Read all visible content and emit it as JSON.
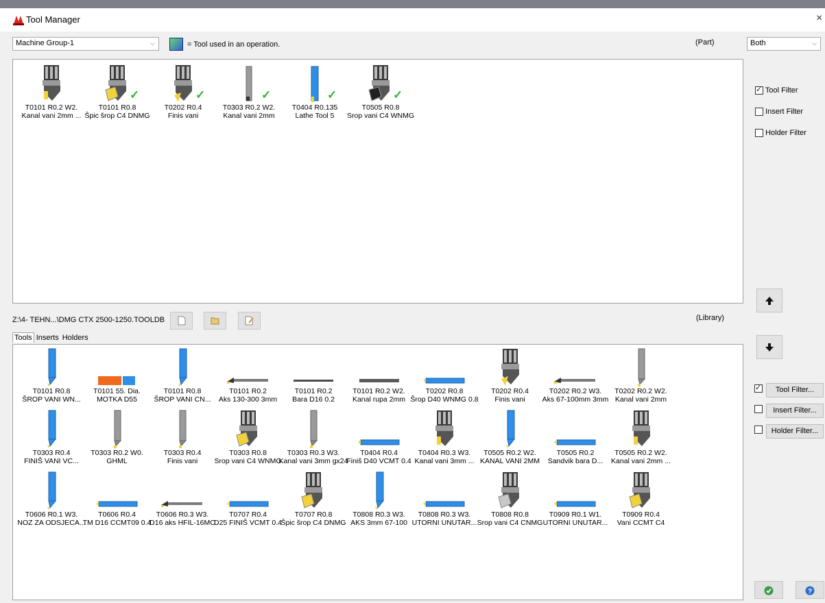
{
  "window": {
    "title": "Tool Manager",
    "close": "×"
  },
  "header": {
    "group_select": "Machine Group-1",
    "legend_text": "= Tool used in an operation.",
    "part_label": "(Part)",
    "both_select": "Both"
  },
  "part_tools": [
    {
      "l1": "T0101 R0.2 W2.",
      "l2": "Kanal vani 2mm ...",
      "used": false,
      "icon": "holder-grooving"
    },
    {
      "l1": "T0101 R0.8",
      "l2": "Špic šrop C4 DNMG",
      "used": true,
      "icon": "holder-insert-yellow"
    },
    {
      "l1": "T0202 R0.4",
      "l2": "Finis vani",
      "used": true,
      "icon": "holder-finish"
    },
    {
      "l1": "T0303 R0.2 W2.",
      "l2": "Kanal vani 2mm",
      "used": true,
      "icon": "grooving-bar"
    },
    {
      "l1": "T0404 R0.135",
      "l2": "Lathe Tool 5",
      "used": true,
      "icon": "blue-bar-tool"
    },
    {
      "l1": "T0505 R0.8",
      "l2": "Srop vani C4 WNMG",
      "used": true,
      "icon": "holder-insert-black"
    }
  ],
  "part_filters": [
    {
      "label": "Tool Filter",
      "checked": true
    },
    {
      "label": "Insert Filter",
      "checked": false
    },
    {
      "label": "Holder Filter",
      "checked": false
    }
  ],
  "library": {
    "path": "Z:\\4- TEHN...\\DMG CTX 2500-1250.TOOLDB",
    "label": "(Library)",
    "tabs": [
      "Tools",
      "Inserts",
      "Holders"
    ],
    "tools": [
      {
        "l1": "T0101 R0.8",
        "l2": "ŠROP VANI WN...",
        "icon": "blue-vertical-tool"
      },
      {
        "l1": "T0101 55. Dia.",
        "l2": "MOTKA D55",
        "icon": "orange-blue-bar"
      },
      {
        "l1": "T0101 R0.8",
        "l2": "ŠROP VANI CN...",
        "icon": "blue-vertical-tool"
      },
      {
        "l1": "T0101 R0.2",
        "l2": "Aks 130-300 3mm",
        "icon": "boring-bar-gray"
      },
      {
        "l1": "T0101 R0.2",
        "l2": "Bara D16 0.2",
        "icon": "thin-bar-gray"
      },
      {
        "l1": "T0101 R0.2 W2.",
        "l2": "Kanal rupa 2mm",
        "icon": "thick-bar-gray"
      },
      {
        "l1": "T0202 R0.8",
        "l2": "Šrop D40 WNMG 0.8",
        "icon": "blue-bar-horizontal"
      },
      {
        "l1": "T0202 R0.4",
        "l2": "Finis vani",
        "icon": "holder-finish"
      },
      {
        "l1": "T0202 R0.2 W3.",
        "l2": "Aks 67-100mm 3mm",
        "icon": "boring-bar-gray"
      },
      {
        "l1": "T0202 R0.2 W2.",
        "l2": "Kanal vani 2mm",
        "icon": "gray-vertical-tool"
      },
      {
        "l1": "T0303 R0.4",
        "l2": "FINIŠ VANI VC...",
        "icon": "blue-vertical-tool"
      },
      {
        "l1": "T0303 R0.2 W0.",
        "l2": "GHML",
        "icon": "gray-vertical-tool"
      },
      {
        "l1": "T0303 R0.4",
        "l2": "Finis vani",
        "icon": "gray-vertical-tool"
      },
      {
        "l1": "T0303 R0.8",
        "l2": "Srop vani C4 WNMG",
        "icon": "holder-insert-yellow"
      },
      {
        "l1": "T0303 R0.3 W3.",
        "l2": "Kanal vani 3mm gx24",
        "icon": "gray-vertical-tool"
      },
      {
        "l1": "T0404 R0.4",
        "l2": "Finiš D40 VCMT 0.4",
        "icon": "blue-bar-horizontal"
      },
      {
        "l1": "T0404 R0.3 W3.",
        "l2": "Kanal vani 3mm ...",
        "icon": "holder-grooving"
      },
      {
        "l1": "T0505 R0.2 W2.",
        "l2": "KANAL VANI 2MM",
        "icon": "blue-vertical-tool"
      },
      {
        "l1": "T0505 R0.2",
        "l2": "Sandvik bara D...",
        "icon": "blue-bar-horizontal"
      },
      {
        "l1": "T0505 R0.2 W2.",
        "l2": "Kanal vani 2mm ...",
        "icon": "holder-grooving"
      },
      {
        "l1": "T0606 R0.1 W3.",
        "l2": "NOZ ZA ODSJECA...",
        "icon": "blue-vertical-tool"
      },
      {
        "l1": "T0606 R0.4",
        "l2": "TM D16 CCMT09 0.4",
        "icon": "blue-bar-horizontal"
      },
      {
        "l1": "T0606 R0.3 W3.",
        "l2": "D16 aks HFIL-16MC",
        "icon": "boring-bar-gray"
      },
      {
        "l1": "T0707 R0.4",
        "l2": "D25 FINIŠ VCMT 0.4",
        "icon": "blue-bar-horizontal"
      },
      {
        "l1": "T0707 R0.8",
        "l2": "Špic šrop C4 DNMG",
        "icon": "holder-insert-yellow"
      },
      {
        "l1": "T0808 R0.3 W3.",
        "l2": "AKS 3mm 67-100",
        "icon": "blue-vertical-tool"
      },
      {
        "l1": "T0808 R0.3 W3.",
        "l2": "UTORNI UNUTAR...",
        "icon": "blue-bar-horizontal"
      },
      {
        "l1": "T0808 R0.8",
        "l2": "Srop vani C4 CNMG",
        "icon": "holder-insert-gray"
      },
      {
        "l1": "T0909 R0.1 W1.",
        "l2": "UTORNI UNUTAR...",
        "icon": "blue-bar-horizontal"
      },
      {
        "l1": "T0909 R0.4",
        "l2": "Vani CCMT C4",
        "icon": "holder-insert-yellow"
      }
    ]
  },
  "lib_filters": [
    {
      "label": "Tool Filter...",
      "checked": true
    },
    {
      "label": "Insert Filter...",
      "checked": false
    },
    {
      "label": "Holder Filter...",
      "checked": false
    }
  ],
  "colors": {
    "tool_blue": "#2f8fe8",
    "check_green": "#2db52d",
    "orange": "#f06a1e"
  }
}
